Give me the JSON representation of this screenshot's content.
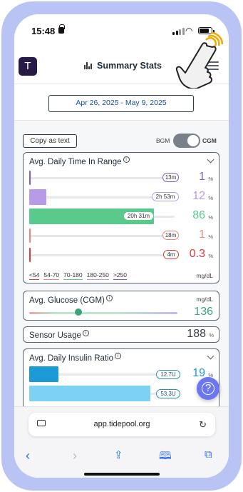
{
  "status_bar": {
    "time": "15:48"
  },
  "header": {
    "logo_glyph": "T",
    "title": "Summary Stats",
    "menu_icon": "hamburger-menu-icon"
  },
  "date_range": {
    "label": "Apr 26, 2025 - May 9, 2025"
  },
  "controls": {
    "copy_label": "Copy as text",
    "toggle_left": "BGM",
    "toggle_right": "CGM",
    "selected": "CGM"
  },
  "time_in_range": {
    "title": "Avg. Daily Time In Range",
    "rows": [
      {
        "duration": "13m",
        "value": "1",
        "unit": "%",
        "color": "#7b5fd6",
        "fill": 0.01
      },
      {
        "duration": "2h 53m",
        "value": "12",
        "unit": "%",
        "color": "#b79ae8",
        "fill": 0.12
      },
      {
        "duration": "20h 31m",
        "value": "86",
        "unit": "%",
        "color": "#59c98c",
        "fill": 0.86
      },
      {
        "duration": "18m",
        "value": "1",
        "unit": "%",
        "color": "#f08479",
        "fill": 0.01
      },
      {
        "duration": "4m",
        "value": "0.3",
        "unit": "%",
        "color": "#e03a3a",
        "fill": 0.003
      }
    ],
    "legend": [
      {
        "label": "<54",
        "color": "#e03a3a"
      },
      {
        "label": "54-70",
        "color": "#f08479"
      },
      {
        "label": "70-180",
        "color": "#59c98c"
      },
      {
        "label": "180-250",
        "color": "#b79ae8"
      },
      {
        "label": ">250",
        "color": "#7b5fd6"
      }
    ],
    "unit": "mg/dL"
  },
  "avg_glucose": {
    "title": "Avg. Glucose (CGM)",
    "unit": "mg/dL",
    "value": "136",
    "marker_fraction": 0.33,
    "color": "#3aa57a"
  },
  "sensor_usage": {
    "title": "Sensor Usage",
    "value": "188",
    "unit": "%"
  },
  "insulin_ratio": {
    "title": "Avg. Daily Insulin Ratio",
    "rows": [
      {
        "amount": "12.7U",
        "value": "19",
        "unit": "%",
        "color": "#1b9ad6",
        "fill": 0.19
      },
      {
        "amount": "53.3U",
        "value": "",
        "unit": "",
        "color": "#7dd1f3",
        "fill": 0.81
      }
    ]
  },
  "browser": {
    "url": "app.tidepool.org"
  }
}
